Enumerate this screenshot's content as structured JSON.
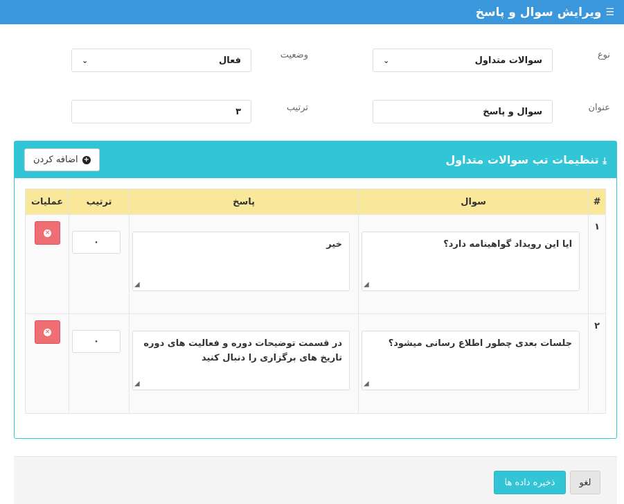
{
  "header": {
    "title": "ویرایش سوال و پاسخ",
    "icon": "list-icon"
  },
  "form": {
    "type_label": "نوع",
    "type_value": "سوالات متداول",
    "status_label": "وضعیت",
    "status_value": "فعال",
    "title_label": "عنوان",
    "title_value": "سوال و پاسخ",
    "order_label": "ترتیب",
    "order_value": "۳"
  },
  "panel": {
    "title": "تنظیمات تب سوالات متداول",
    "icon": "download-icon",
    "add_label": "اضافه کردن"
  },
  "table": {
    "headers": [
      "#",
      "سوال",
      "پاسخ",
      "ترتیب",
      "عملیات"
    ],
    "rows": [
      {
        "num": "۱",
        "question": "ایا این رویداد گواهینامه دارد؟",
        "answer": "خیر",
        "order": "۰"
      },
      {
        "num": "۲",
        "question": "جلسات بعدی چطور اطلاع رسانی میشود؟",
        "answer": "در قسمت توضیحات دوره و فعالیت های دوره تاریخ های برگزاری را دنبال کنید",
        "order": "۰"
      }
    ]
  },
  "footer": {
    "save_label": "ذخیره داده ها",
    "cancel_label": "لغو"
  },
  "colors": {
    "header": "#3a97dc",
    "panel": "#31c5d6",
    "table_head": "#f9e79a",
    "danger": "#ef6e73"
  }
}
